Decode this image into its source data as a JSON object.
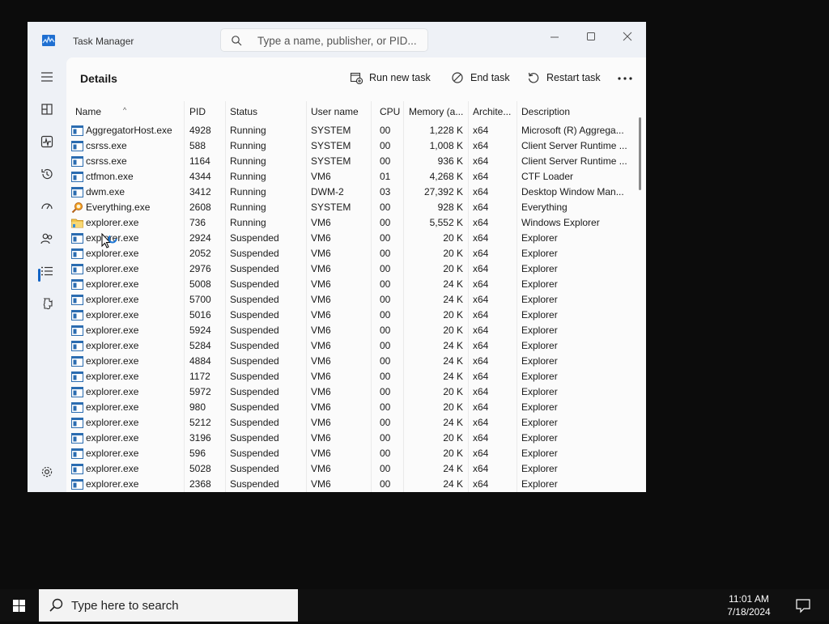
{
  "window": {
    "title": "Task Manager",
    "search_placeholder": "Type a name, publisher, or PID..."
  },
  "nav": {
    "items": [
      {
        "name": "menu-icon"
      },
      {
        "name": "processes-icon"
      },
      {
        "name": "performance-icon"
      },
      {
        "name": "app-history-icon"
      },
      {
        "name": "startup-apps-icon"
      },
      {
        "name": "users-icon"
      },
      {
        "name": "details-icon"
      },
      {
        "name": "services-icon"
      }
    ],
    "active": "details",
    "settings_icon": "gear-icon"
  },
  "page": {
    "title": "Details",
    "commands": {
      "run_new_task": "Run new task",
      "end_task": "End task",
      "restart_task": "Restart task"
    }
  },
  "table": {
    "columns": [
      "Name",
      "PID",
      "Status",
      "User name",
      "CPU",
      "Memory (a...",
      "Archite...",
      "Description"
    ],
    "sorted_column": "Name",
    "rows": [
      {
        "icon": "app",
        "name": "AggregatorHost.exe",
        "pid": "4928",
        "status": "Running",
        "user": "SYSTEM",
        "cpu": "00",
        "mem": "1,228 K",
        "arch": "x64",
        "desc": "Microsoft (R) Aggrega..."
      },
      {
        "icon": "app",
        "name": "csrss.exe",
        "pid": "588",
        "status": "Running",
        "user": "SYSTEM",
        "cpu": "00",
        "mem": "1,008 K",
        "arch": "x64",
        "desc": "Client Server Runtime ..."
      },
      {
        "icon": "app",
        "name": "csrss.exe",
        "pid": "1164",
        "status": "Running",
        "user": "SYSTEM",
        "cpu": "00",
        "mem": "936 K",
        "arch": "x64",
        "desc": "Client Server Runtime ..."
      },
      {
        "icon": "app",
        "name": "ctfmon.exe",
        "pid": "4344",
        "status": "Running",
        "user": "VM6",
        "cpu": "01",
        "mem": "4,268 K",
        "arch": "x64",
        "desc": "CTF Loader"
      },
      {
        "icon": "app",
        "name": "dwm.exe",
        "pid": "3412",
        "status": "Running",
        "user": "DWM-2",
        "cpu": "03",
        "mem": "27,392 K",
        "arch": "x64",
        "desc": "Desktop Window Man..."
      },
      {
        "icon": "search",
        "name": "Everything.exe",
        "pid": "2608",
        "status": "Running",
        "user": "SYSTEM",
        "cpu": "00",
        "mem": "928 K",
        "arch": "x64",
        "desc": "Everything"
      },
      {
        "icon": "folder",
        "name": "explorer.exe",
        "pid": "736",
        "status": "Running",
        "user": "VM6",
        "cpu": "00",
        "mem": "5,552 K",
        "arch": "x64",
        "desc": "Windows Explorer"
      },
      {
        "icon": "app",
        "name": "explorer.exe",
        "pid": "2924",
        "status": "Suspended",
        "user": "VM6",
        "cpu": "00",
        "mem": "20 K",
        "arch": "x64",
        "desc": "Explorer"
      },
      {
        "icon": "app",
        "name": "explorer.exe",
        "pid": "2052",
        "status": "Suspended",
        "user": "VM6",
        "cpu": "00",
        "mem": "20 K",
        "arch": "x64",
        "desc": "Explorer"
      },
      {
        "icon": "app",
        "name": "explorer.exe",
        "pid": "2976",
        "status": "Suspended",
        "user": "VM6",
        "cpu": "00",
        "mem": "20 K",
        "arch": "x64",
        "desc": "Explorer"
      },
      {
        "icon": "app",
        "name": "explorer.exe",
        "pid": "5008",
        "status": "Suspended",
        "user": "VM6",
        "cpu": "00",
        "mem": "24 K",
        "arch": "x64",
        "desc": "Explorer"
      },
      {
        "icon": "app",
        "name": "explorer.exe",
        "pid": "5700",
        "status": "Suspended",
        "user": "VM6",
        "cpu": "00",
        "mem": "24 K",
        "arch": "x64",
        "desc": "Explorer"
      },
      {
        "icon": "app",
        "name": "explorer.exe",
        "pid": "5016",
        "status": "Suspended",
        "user": "VM6",
        "cpu": "00",
        "mem": "20 K",
        "arch": "x64",
        "desc": "Explorer"
      },
      {
        "icon": "app",
        "name": "explorer.exe",
        "pid": "5924",
        "status": "Suspended",
        "user": "VM6",
        "cpu": "00",
        "mem": "20 K",
        "arch": "x64",
        "desc": "Explorer"
      },
      {
        "icon": "app",
        "name": "explorer.exe",
        "pid": "5284",
        "status": "Suspended",
        "user": "VM6",
        "cpu": "00",
        "mem": "24 K",
        "arch": "x64",
        "desc": "Explorer"
      },
      {
        "icon": "app",
        "name": "explorer.exe",
        "pid": "4884",
        "status": "Suspended",
        "user": "VM6",
        "cpu": "00",
        "mem": "24 K",
        "arch": "x64",
        "desc": "Explorer"
      },
      {
        "icon": "app",
        "name": "explorer.exe",
        "pid": "1172",
        "status": "Suspended",
        "user": "VM6",
        "cpu": "00",
        "mem": "24 K",
        "arch": "x64",
        "desc": "Explorer"
      },
      {
        "icon": "app",
        "name": "explorer.exe",
        "pid": "5972",
        "status": "Suspended",
        "user": "VM6",
        "cpu": "00",
        "mem": "20 K",
        "arch": "x64",
        "desc": "Explorer"
      },
      {
        "icon": "app",
        "name": "explorer.exe",
        "pid": "980",
        "status": "Suspended",
        "user": "VM6",
        "cpu": "00",
        "mem": "20 K",
        "arch": "x64",
        "desc": "Explorer"
      },
      {
        "icon": "app",
        "name": "explorer.exe",
        "pid": "5212",
        "status": "Suspended",
        "user": "VM6",
        "cpu": "00",
        "mem": "24 K",
        "arch": "x64",
        "desc": "Explorer"
      },
      {
        "icon": "app",
        "name": "explorer.exe",
        "pid": "3196",
        "status": "Suspended",
        "user": "VM6",
        "cpu": "00",
        "mem": "20 K",
        "arch": "x64",
        "desc": "Explorer"
      },
      {
        "icon": "app",
        "name": "explorer.exe",
        "pid": "596",
        "status": "Suspended",
        "user": "VM6",
        "cpu": "00",
        "mem": "20 K",
        "arch": "x64",
        "desc": "Explorer"
      },
      {
        "icon": "app",
        "name": "explorer.exe",
        "pid": "5028",
        "status": "Suspended",
        "user": "VM6",
        "cpu": "00",
        "mem": "24 K",
        "arch": "x64",
        "desc": "Explorer"
      },
      {
        "icon": "app",
        "name": "explorer.exe",
        "pid": "2368",
        "status": "Suspended",
        "user": "VM6",
        "cpu": "00",
        "mem": "24 K",
        "arch": "x64",
        "desc": "Explorer"
      }
    ]
  },
  "taskbar": {
    "search_placeholder": "Type here to search",
    "time": "11:01 AM",
    "date": "7/18/2024"
  },
  "colors": {
    "accent": "#1163c4",
    "window_bg": "#eef1f6",
    "content_bg": "#fbfbfb",
    "desktop": "#0c0c0c"
  }
}
